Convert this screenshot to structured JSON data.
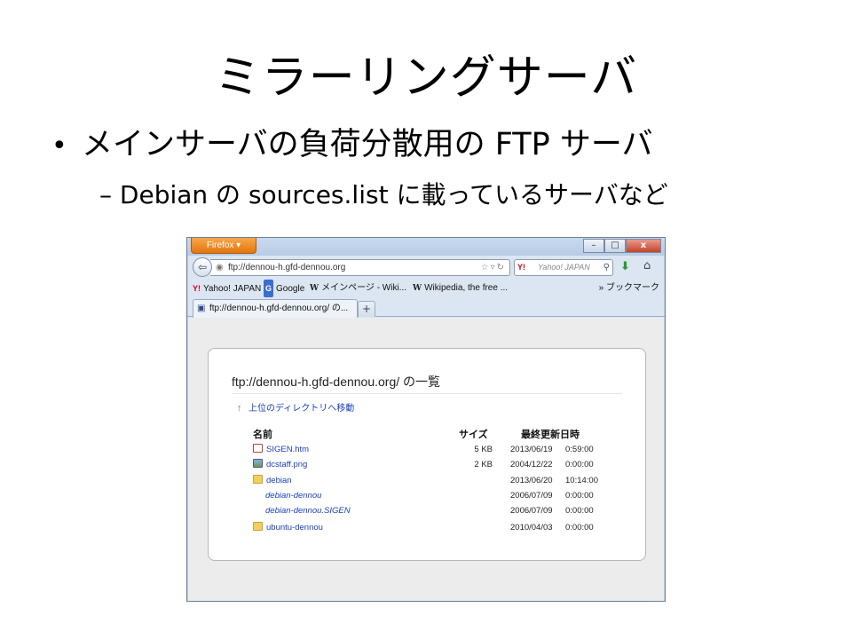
{
  "slide": {
    "title": "ミラーリングサーバ",
    "bullet1": "メインサーバの負荷分散用の FTP サーバ",
    "bullet2": "– Debian の sources.list に載っているサーバなど"
  },
  "browser": {
    "firefox_button": "Firefox ▾",
    "window_controls": {
      "min": "–",
      "max": "□",
      "close": "x"
    },
    "url": "ftp://dennou-h.gfd-dennou.org",
    "search_placeholder": "Yahoo! JAPAN",
    "search_engine": "Y!",
    "bookmarks": [
      {
        "icon": "Y!",
        "label": "Yahoo! JAPAN"
      },
      {
        "icon": "G",
        "label": "Google"
      },
      {
        "icon": "W",
        "label": "メインページ - Wiki..."
      },
      {
        "icon": "W",
        "label": "Wikipedia, the free ..."
      }
    ],
    "bookmarks_menu": "» ブックマーク",
    "tab_title": "ftp://dennou-h.gfd-dennou.org/ の...",
    "new_tab": "+"
  },
  "listing": {
    "title": "ftp://dennou-h.gfd-dennou.org/ の一覧",
    "up_link": "上位のディレクトリへ移動",
    "headers": {
      "name": "名前",
      "size": "サイズ",
      "modified": "最終更新日時"
    },
    "rows": [
      {
        "name": "SIGEN.htm",
        "size": "5 KB",
        "date": "2013/06/19",
        "time": "0:59:00",
        "kind": "htm"
      },
      {
        "name": "dcstaff.png",
        "size": "2 KB",
        "date": "2004/12/22",
        "time": "0:00:00",
        "kind": "png"
      },
      {
        "name": "debian",
        "size": "",
        "date": "2013/06/20",
        "time": "10:14:00",
        "kind": "folder"
      },
      {
        "name": "debian-dennou",
        "size": "",
        "date": "2006/07/09",
        "time": "0:00:00",
        "kind": "link"
      },
      {
        "name": "debian-dennou.SIGEN",
        "size": "",
        "date": "2006/07/09",
        "time": "0:00:00",
        "kind": "link"
      },
      {
        "name": "ubuntu-dennou",
        "size": "",
        "date": "2010/04/03",
        "time": "0:00:00",
        "kind": "folder"
      }
    ]
  }
}
